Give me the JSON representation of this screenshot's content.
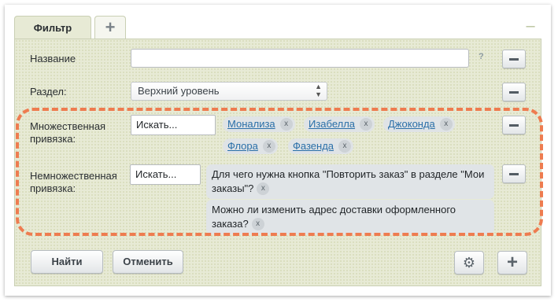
{
  "tabs": {
    "active_label": "Фильтр",
    "add_label": "+"
  },
  "collapse_label": "–",
  "fields": {
    "name": {
      "label": "Название",
      "value": "",
      "placeholder": "",
      "help": "?"
    },
    "section": {
      "label": "Раздел:",
      "selected": "Верхний уровень"
    },
    "multi": {
      "label_line1": "Множественная",
      "label_line2": "привязка:",
      "search_text": "Искать...",
      "chips": [
        "Монализа",
        "Изабелла",
        "Джоконда",
        "Флора",
        "Фазенда"
      ],
      "chip_remove": "x"
    },
    "single": {
      "label_line1": "Немножественная",
      "label_line2": "привязка:",
      "search_text": "Искать...",
      "cards": [
        "Для чего нужна кнопка \"Повторить заказ\" в разделе \"Мои заказы\"?",
        "Можно ли изменить адрес доставки оформленного заказа?"
      ],
      "card_remove": "x"
    }
  },
  "buttons": {
    "find": "Найти",
    "cancel": "Отменить",
    "settings_icon": "gear-icon",
    "add_icon": "plus-icon"
  },
  "colors": {
    "panel_bg": "#e7ead5",
    "highlight_dash": "#ee7c50",
    "link": "#2a6fa8",
    "chip_bg": "#dfe3e6"
  }
}
